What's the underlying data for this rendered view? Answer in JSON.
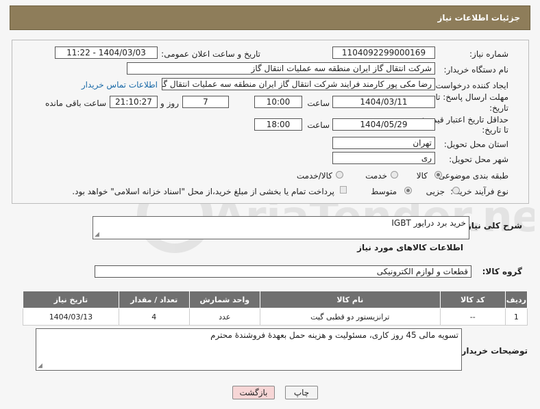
{
  "header": {
    "title": "جزئیات اطلاعات نیاز"
  },
  "form": {
    "need_number": {
      "label": "شماره نیاز:",
      "value": "1104092299000169"
    },
    "announce": {
      "label": "تاریخ و ساعت اعلان عمومی:",
      "value": "1404/03/03 - 11:22"
    },
    "buyer": {
      "label": "نام دستگاه خریدار:",
      "value": "شرکت انتقال گاز ایران منطقه سه عملیات انتقال گاز"
    },
    "creator": {
      "label": "ایجاد کننده درخواست:",
      "value": "رضا مکی پور کارمند فرایند شرکت انتقال گاز ایران منطقه سه عملیات انتقال گاز",
      "contact_link": "اطلاعات تماس خریدار"
    },
    "deadline": {
      "label_line1": "مهلت ارسال پاسخ: تا",
      "label_line2": "تاریخ:",
      "date": "1404/03/11",
      "time_label": "ساعت",
      "time": "10:00",
      "days": "7",
      "days_label": "روز و",
      "remaining": "21:10:27",
      "remaining_label": "ساعت باقی مانده"
    },
    "price_validity": {
      "label_line1": "حداقل تاریخ اعتبار قیمت:",
      "label_line2": "تا تاریخ:",
      "date": "1404/05/29",
      "time_label": "ساعت",
      "time": "18:00"
    },
    "province": {
      "label": "استان محل تحویل:",
      "value": "تهران"
    },
    "city": {
      "label": "شهر محل تحویل:",
      "value": "ری"
    },
    "category": {
      "label": "طبقه بندی موضوعی:",
      "options": [
        "کالا",
        "خدمت",
        "کالا/خدمت"
      ],
      "selected": "کالا"
    },
    "process": {
      "label": "نوع فرآیند خرید :",
      "options": [
        "جزیی",
        "متوسط"
      ],
      "selected": "متوسط",
      "payment_note": "پرداخت تمام یا بخشی از مبلغ خرید،از محل \"اسناد خزانه اسلامی\" خواهد بود."
    }
  },
  "description": {
    "label": "شرح کلی نیاز:",
    "value": "خرید برد درایور IGBT"
  },
  "goods_info": {
    "title": "اطلاعات کالاهای مورد نیاز",
    "group_label": "گروه کالا:",
    "group_value": "قطعات و لوازم الکترونیکی",
    "columns": [
      "ردیف",
      "کد کالا",
      "نام کالا",
      "واحد شمارش",
      "تعداد / مقدار",
      "تاریخ نیاز"
    ],
    "rows": [
      [
        "1",
        "--",
        "ترانزیستور دو قطبی گیت",
        "عدد",
        "4",
        "1404/03/13"
      ]
    ]
  },
  "buyer_notes": {
    "label": "توضیحات خریدار:",
    "value": "تسویه مالی 45 روز کاری، مسئولیت و هزینه حمل بعهدۀ فروشندۀ محترم"
  },
  "buttons": {
    "print": "چاپ",
    "back": "بازگشت"
  },
  "watermark": {
    "text": "AriaTender.neT"
  },
  "colors": {
    "header_bg": "#8e7d5a",
    "table_header_bg": "#707070",
    "link": "#1a6aa8",
    "back_button_bg": "#f7d6d6"
  }
}
